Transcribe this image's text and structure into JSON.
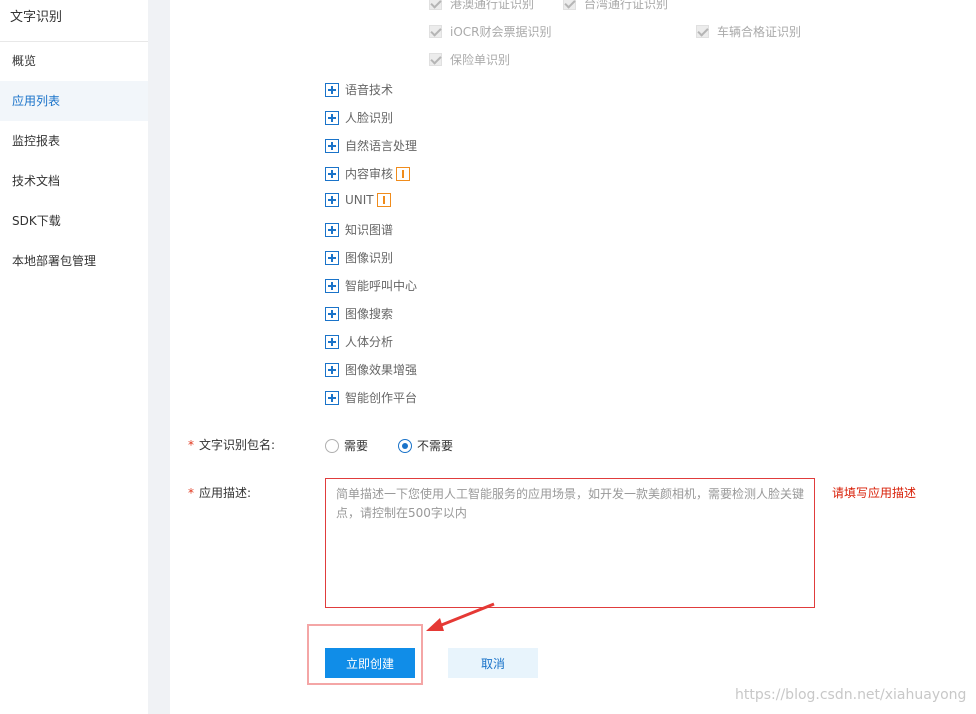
{
  "sidebar": {
    "title": "文字识别",
    "items": [
      {
        "label": "概览",
        "active": false
      },
      {
        "label": "应用列表",
        "active": true
      },
      {
        "label": "监控报表",
        "active": false
      },
      {
        "label": "技术文档",
        "active": false
      },
      {
        "label": "SDK下载",
        "active": false
      },
      {
        "label": "本地部署包管理",
        "active": false
      }
    ]
  },
  "checkboxes": {
    "hk_macau": "港澳通行证识别",
    "taiwan": "台湾通行证识别",
    "iocr_finance": "iOCR财会票据识别",
    "vehicle_cert": "车辆合格证识别",
    "insurance": "保险单识别"
  },
  "tree_items": [
    {
      "label": "语音技术",
      "badge": false
    },
    {
      "label": "人脸识别",
      "badge": false
    },
    {
      "label": "自然语言处理",
      "badge": false
    },
    {
      "label": "内容审核",
      "badge": true
    },
    {
      "label": "UNIT",
      "badge": true
    },
    {
      "label": "知识图谱",
      "badge": false
    },
    {
      "label": "图像识别",
      "badge": false
    },
    {
      "label": "智能呼叫中心",
      "badge": false
    },
    {
      "label": "图像搜索",
      "badge": false
    },
    {
      "label": "人体分析",
      "badge": false
    },
    {
      "label": "图像效果增强",
      "badge": false
    },
    {
      "label": "智能创作平台",
      "badge": false
    }
  ],
  "form": {
    "package_label": "文字识别包名:",
    "package_options": [
      "需要",
      "不需要"
    ],
    "package_selected": "不需要",
    "desc_label": "应用描述:",
    "desc_placeholder": "简单描述一下您使用人工智能服务的应用场景，如开发一款美颜相机，需要检测人脸关键点，请控制在500字以内",
    "desc_value": "",
    "desc_error": "请填写应用描述",
    "required_mark": "*"
  },
  "actions": {
    "create": "立即创建",
    "cancel": "取消"
  },
  "watermark": "https://blog.csdn.net/xiahuayong",
  "colors": {
    "accent": "#108de8",
    "error": "#d81e06",
    "badge": "#f08c1c"
  }
}
